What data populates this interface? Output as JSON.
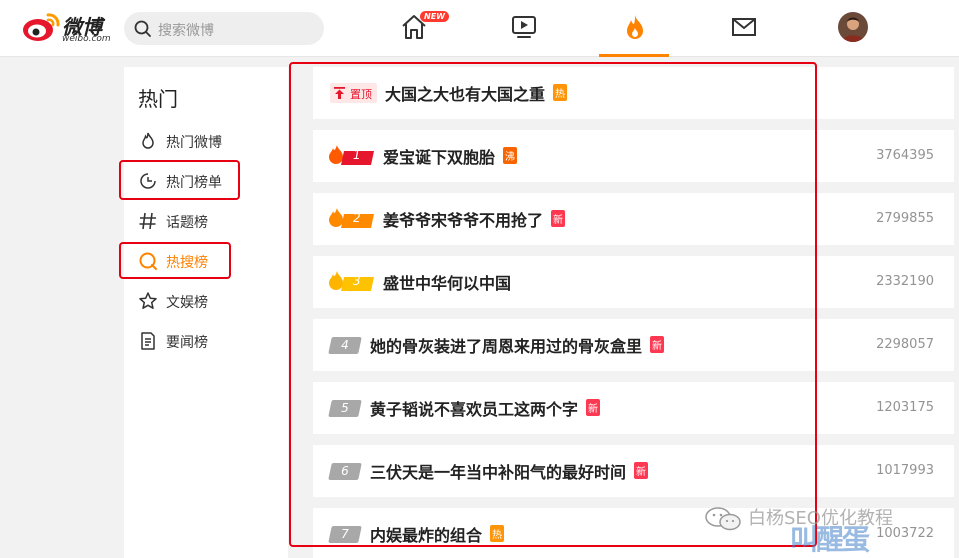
{
  "header": {
    "logo_text": "微博",
    "logo_domain": "weibo.com",
    "search_placeholder": "搜索微博",
    "new_badge": "NEW"
  },
  "sidebar": {
    "title": "热门",
    "items": [
      {
        "label": "热门微博",
        "icon": "fire-outline-icon",
        "active": false
      },
      {
        "label": "热门榜单",
        "icon": "clock-chart-icon",
        "active": false
      },
      {
        "label": "话题榜",
        "icon": "hashtag-icon",
        "active": false
      },
      {
        "label": "热搜榜",
        "icon": "search-circle-icon",
        "active": true
      },
      {
        "label": "文娱榜",
        "icon": "star-icon",
        "active": false
      },
      {
        "label": "要闻榜",
        "icon": "document-icon",
        "active": false
      }
    ]
  },
  "list": {
    "pinned": {
      "pin_label": "置顶",
      "title": "大国之大也有大国之重",
      "tag": "热"
    },
    "rows": [
      {
        "rank": "1",
        "title": "爱宝诞下双胞胎",
        "tag": "沸",
        "tag_type": "boil",
        "count": "3764395"
      },
      {
        "rank": "2",
        "title": "姜爷爷宋爷爷不用抢了",
        "tag": "新",
        "tag_type": "new",
        "count": "2799855"
      },
      {
        "rank": "3",
        "title": "盛世中华何以中国",
        "tag": "",
        "tag_type": "",
        "count": "2332190"
      },
      {
        "rank": "4",
        "title": "她的骨灰装进了周恩来用过的骨灰盒里",
        "tag": "新",
        "tag_type": "new",
        "count": "2298057"
      },
      {
        "rank": "5",
        "title": "黄子韬说不喜欢员工这两个字",
        "tag": "新",
        "tag_type": "new",
        "count": "1203175"
      },
      {
        "rank": "6",
        "title": "三伏天是一年当中补阳气的最好时间",
        "tag": "新",
        "tag_type": "new",
        "count": "1017993"
      },
      {
        "rank": "7",
        "title": "内娱最炸的组合",
        "tag": "热",
        "tag_type": "hot",
        "count": "1003722"
      }
    ]
  },
  "watermark": {
    "text": "白杨SEO优化教程",
    "logo": "叫醒蛋"
  },
  "colors": {
    "accent": "#ff8200",
    "highlight_box": "#e60012",
    "rank_gray": "#a8a8a8"
  }
}
